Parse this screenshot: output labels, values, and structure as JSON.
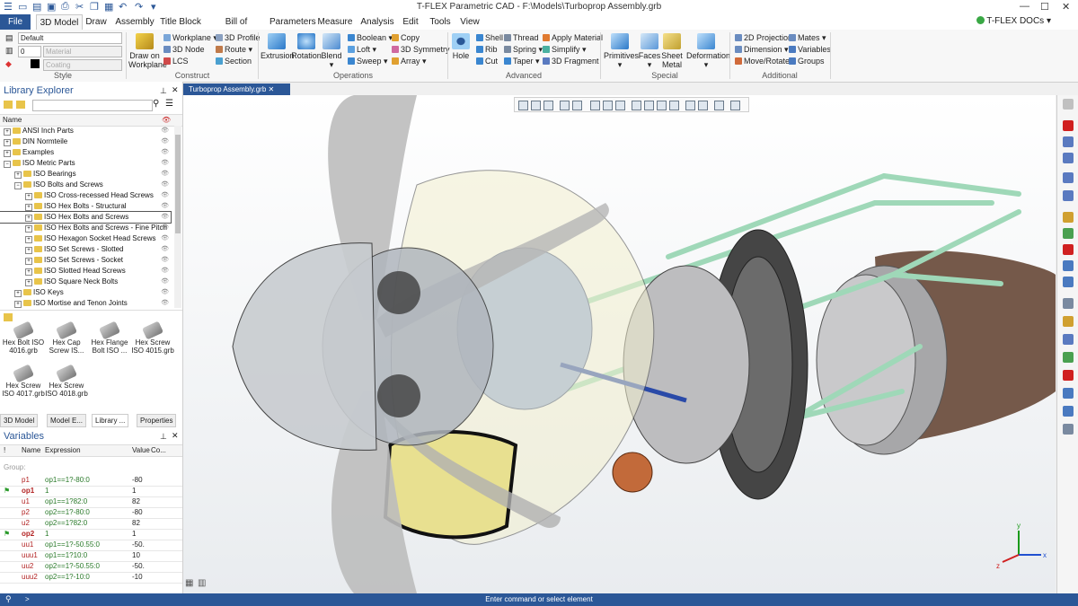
{
  "app": {
    "title": "T-FLEX Parametric CAD - F:\\Models\\Turboprop Assembly.grb",
    "docs_button": "T-FLEX DOCs"
  },
  "ribbon_tabs": [
    "File",
    "3D Model",
    "Draw",
    "Assembly",
    "Title Block",
    "Bill of Materials",
    "Parameters",
    "Measure",
    "Analysis",
    "Edit",
    "Tools",
    "View"
  ],
  "ribbon": {
    "style": {
      "label": "Style",
      "layer_value": "Default",
      "level_value": "0",
      "material_placeholder": "Material",
      "coating_placeholder": "Coating"
    },
    "construct": {
      "label": "Construct",
      "draw_on_workplane": "Draw on Workplane",
      "workplane": "Workplane",
      "node_3d": "3D Node",
      "lcs": "LCS",
      "profile_3d": "3D Profile",
      "route": "Route",
      "section": "Section"
    },
    "operations": {
      "label": "Operations",
      "extrusion": "Extrusion",
      "rotation": "Rotation",
      "blend": "Blend",
      "boolean": "Boolean",
      "loft": "Loft",
      "sweep": "Sweep",
      "copy": "Copy",
      "symmetry_3d": "3D Symmetry",
      "array": "Array"
    },
    "advanced": {
      "label": "Advanced",
      "hole": "Hole",
      "shell": "Shell",
      "rib": "Rib",
      "cut": "Cut",
      "thread": "Thread",
      "spring": "Spring",
      "taper": "Taper",
      "apply_material": "Apply Material",
      "simplify": "Simplify",
      "fragment_3d": "3D Fragment"
    },
    "special": {
      "label": "Special",
      "primitives": "Primitives",
      "faces": "Faces",
      "sheet_metal": "Sheet Metal",
      "deformation": "Deformation"
    },
    "additional": {
      "label": "Additional",
      "projection_2d": "2D Projection",
      "dimension": "Dimension",
      "move_rotate": "Move/Rotate",
      "mates": "Mates",
      "variables": "Variables",
      "groups": "Groups"
    }
  },
  "library_explorer": {
    "title": "Library Explorer",
    "column_name": "Name",
    "tree": [
      {
        "label": "ANSI Inch Parts",
        "level": 0,
        "expanded": false
      },
      {
        "label": "DIN Normteile",
        "level": 0,
        "expanded": false
      },
      {
        "label": "Examples",
        "level": 0,
        "expanded": false
      },
      {
        "label": "ISO Metric Parts",
        "level": 0,
        "expanded": true
      },
      {
        "label": "ISO Bearings",
        "level": 1,
        "expanded": false
      },
      {
        "label": "ISO Bolts and Screws",
        "level": 1,
        "expanded": true
      },
      {
        "label": "ISO Cross-recessed Head Screws",
        "level": 2,
        "expanded": false
      },
      {
        "label": "ISO Hex Bolts - Structural",
        "level": 2,
        "expanded": false
      },
      {
        "label": "ISO Hex Bolts and Screws",
        "level": 2,
        "expanded": false,
        "selected": true
      },
      {
        "label": "ISO Hex Bolts and Screws - Fine Pitch",
        "level": 2,
        "expanded": false
      },
      {
        "label": "ISO Hexagon Socket Head Screws",
        "level": 2,
        "expanded": false
      },
      {
        "label": "ISO Set Screws - Slotted",
        "level": 2,
        "expanded": false
      },
      {
        "label": "ISO Set Screws - Socket",
        "level": 2,
        "expanded": false
      },
      {
        "label": "ISO Slotted Head Screws",
        "level": 2,
        "expanded": false
      },
      {
        "label": "ISO Square Neck Bolts",
        "level": 2,
        "expanded": false
      },
      {
        "label": "ISO Keys",
        "level": 1,
        "expanded": false
      },
      {
        "label": "ISO Mortise and Tenon Joints",
        "level": 1,
        "expanded": false
      }
    ],
    "files": [
      "Hex Bolt ISO 4016.grb",
      "Hex Cap Screw IS...",
      "Hex Flange Bolt ISO ...",
      "Hex Screw ISO 4015.grb",
      "Hex Screw ISO 4017.grb",
      "Hex Screw ISO 4018.grb"
    ],
    "panel_tabs": [
      "3D Model",
      "Model E...",
      "Library ...",
      "Properties"
    ]
  },
  "variables": {
    "title": "Variables",
    "columns": [
      "!",
      "Name",
      "Expression",
      "Value",
      "Co..."
    ],
    "group_label": "Group:",
    "rows": [
      {
        "flag": false,
        "name": "p1",
        "expr": "op1==1?-80:0",
        "value": "-80",
        "bold": false
      },
      {
        "flag": true,
        "name": "op1",
        "expr": "1",
        "value": "1",
        "bold": true
      },
      {
        "flag": false,
        "name": "u1",
        "expr": "op1==1?82:0",
        "value": "82",
        "bold": false
      },
      {
        "flag": false,
        "name": "p2",
        "expr": "op2==1?-80:0",
        "value": "-80",
        "bold": false
      },
      {
        "flag": false,
        "name": "u2",
        "expr": "op2==1?82:0",
        "value": "82",
        "bold": false
      },
      {
        "flag": true,
        "name": "op2",
        "expr": "1",
        "value": "1",
        "bold": true
      },
      {
        "flag": false,
        "name": "uu1",
        "expr": "op1==1?-50.55:0",
        "value": "-50.",
        "bold": false
      },
      {
        "flag": false,
        "name": "uuu1",
        "expr": "op1==1?10:0",
        "value": "10",
        "bold": false
      },
      {
        "flag": false,
        "name": "uu2",
        "expr": "op2==1?-50.55:0",
        "value": "-50.",
        "bold": false
      },
      {
        "flag": false,
        "name": "uuu2",
        "expr": "op2==1?-10:0",
        "value": "-10",
        "bold": false
      }
    ]
  },
  "document_tab": "Turboprop Assembly.grb",
  "status": {
    "command_prompt": "Enter command or select element",
    "prompt_symbol": ">"
  },
  "colors": {
    "accent": "#2b5797",
    "frame_tube": "#a8dcc0",
    "nacelle": "#7a5a4a",
    "engine_blue": "#8fa8d8",
    "spinner": "#c8ccd0"
  }
}
